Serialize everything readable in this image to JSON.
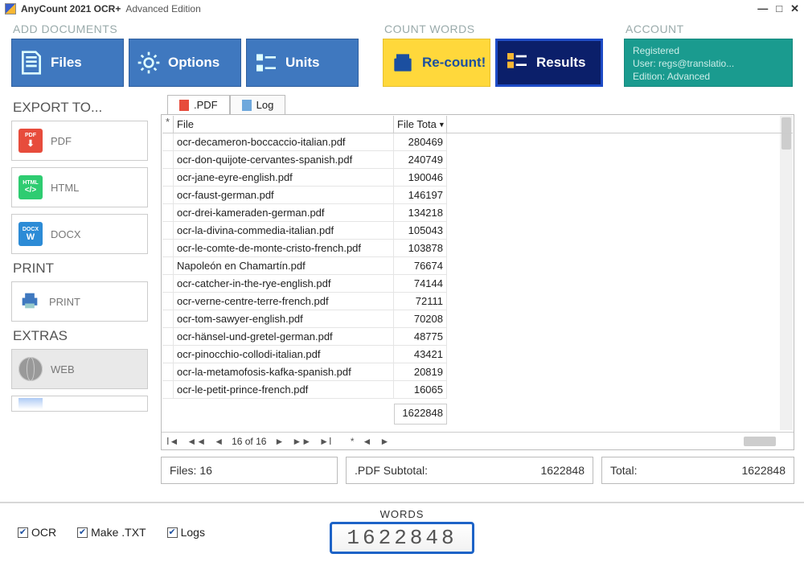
{
  "title": {
    "app": "AnyCount 2021 OCR+",
    "edition": "Advanced Edition"
  },
  "ribbon": {
    "add_documents": "ADD DOCUMENTS",
    "count_words": "COUNT WORDS",
    "account_label": "ACCOUNT",
    "files": "Files",
    "options": "Options",
    "units": "Units",
    "recount": "Re-count!",
    "results": "Results",
    "account": {
      "line1": "Registered",
      "line2": "User: regs@translatio...",
      "line3": "Edition: Advanced"
    }
  },
  "side": {
    "export": "EXPORT TO...",
    "pdf": "PDF",
    "html": "HTML",
    "docx": "DOCX",
    "print_h": "PRINT",
    "print": "PRINT",
    "extras": "EXTRAS",
    "web": "WEB"
  },
  "tabs": {
    "pdf": ".PDF",
    "log": "Log"
  },
  "grid": {
    "star": "*",
    "file": "File",
    "total_hdr": "File Tota",
    "sort": "▼",
    "rows": [
      {
        "f": "ocr-decameron-boccaccio-italian.pdf",
        "t": "280469"
      },
      {
        "f": "ocr-don-quijote-cervantes-spanish.pdf",
        "t": "240749"
      },
      {
        "f": "ocr-jane-eyre-english.pdf",
        "t": "190046"
      },
      {
        "f": "ocr-faust-german.pdf",
        "t": "146197"
      },
      {
        "f": "ocr-drei-kameraden-german.pdf",
        "t": "134218"
      },
      {
        "f": "ocr-la-divina-commedia-italian.pdf",
        "t": "105043"
      },
      {
        "f": "ocr-le-comte-de-monte-cristo-french.pdf",
        "t": "103878"
      },
      {
        "f": "Napoleón en Chamartín.pdf",
        "t": "76674"
      },
      {
        "f": "ocr-catcher-in-the-rye-english.pdf",
        "t": "74144"
      },
      {
        "f": "ocr-verne-centre-terre-french.pdf",
        "t": "72111"
      },
      {
        "f": "ocr-tom-sawyer-english.pdf",
        "t": "70208"
      },
      {
        "f": "ocr-hänsel-und-gretel-german.pdf",
        "t": "48775"
      },
      {
        "f": "ocr-pinocchio-collodi-italian.pdf",
        "t": "43421"
      },
      {
        "f": "ocr-la-metamofosis-kafka-spanish.pdf",
        "t": "20819"
      },
      {
        "f": "ocr-le-petit-prince-french.pdf",
        "t": "16065"
      }
    ],
    "sum": "1622848",
    "pager": "16 of 16"
  },
  "stats": {
    "files": "Files: 16",
    "sub_label": ".PDF Subtotal:",
    "sub_val": "1622848",
    "tot_label": "Total:",
    "tot_val": "1622848"
  },
  "footer": {
    "ocr": "OCR",
    "make": "Make .TXT",
    "logs": "Logs",
    "words": "WORDS",
    "counter": "1622848"
  }
}
